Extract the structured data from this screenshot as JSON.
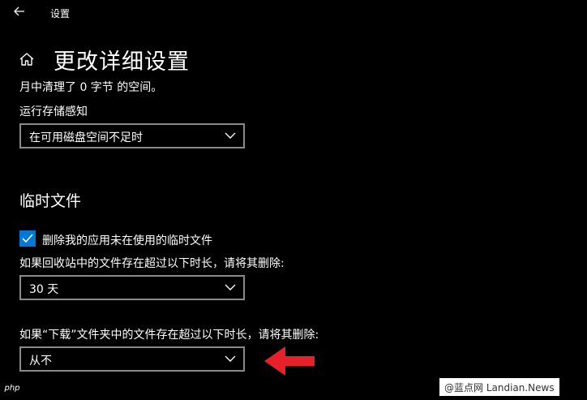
{
  "window": {
    "title": "设置"
  },
  "page": {
    "title": "更改详细设置"
  },
  "storage": {
    "freed_text": "月中清理了 0 字节 的空间。",
    "run_label": "运行存储感知",
    "run_value": "在可用磁盘空间不足时"
  },
  "temp_files": {
    "heading": "临时文件",
    "delete_app_temp_label": "删除我的应用未在使用的临时文件",
    "delete_app_temp_checked": true,
    "recycle_label": "如果回收站中的文件存在超过以下时长，请将其删除:",
    "recycle_value": "30 天",
    "downloads_label": "如果“下载”文件夹中的文件存在超过以下时长，请将其删除:",
    "downloads_value": "从不"
  },
  "annotation": {
    "arrow_color": "#e8202a"
  },
  "watermarks": {
    "php": "php",
    "site": "@蓝点网 Landian.News"
  },
  "colors": {
    "accent": "#0078d7",
    "background": "#000000",
    "border": "#8a8a8a"
  },
  "icons": [
    "back-arrow-icon",
    "home-icon",
    "chevron-down-icon",
    "checkmark-icon",
    "red-arrow-icon"
  ]
}
